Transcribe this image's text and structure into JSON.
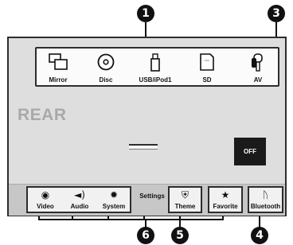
{
  "callouts": [
    "1",
    "3",
    "6",
    "5",
    "4"
  ],
  "sources": [
    {
      "label": "Mirror",
      "icon": "mirror-icon"
    },
    {
      "label": "Disc",
      "icon": "disc-icon"
    },
    {
      "label": "USB/iPod1",
      "icon": "usb-icon"
    },
    {
      "label": "SD",
      "icon": "sd-card-icon"
    },
    {
      "label": "AV",
      "icon": "av-icon"
    }
  ],
  "rear_label": "REAR",
  "off_label": "OFF",
  "bottom": {
    "video_label": "Video",
    "audio_label": "Audio",
    "system_label": "System",
    "settings_label": "Settings",
    "theme_label": "Theme",
    "favorite_label": "Favorite",
    "bluetooth_label": "Bluetooth"
  }
}
